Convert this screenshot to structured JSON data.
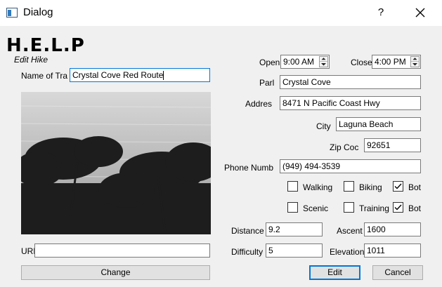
{
  "window": {
    "title": "Dialog",
    "help_label": "?"
  },
  "header": {
    "logo_text": "H.E.L.P",
    "subtitle": "Edit Hike"
  },
  "form": {
    "name_label": "Name of Tra",
    "name_value": "Crystal Cove Red Route",
    "url_label": "URL",
    "url_value": "",
    "change_label": "Change",
    "open_label": "Open",
    "open_value": "9:00 AM",
    "close_label": "Close",
    "close_value": "4:00 PM",
    "park_label": "Parl",
    "park_value": "Crystal Cove",
    "address_label": "Addres",
    "address_value": "8471 N Pacific Coast Hwy",
    "city_label": "City",
    "city_value": "Laguna Beach",
    "zip_label": "Zip Coc",
    "zip_value": "92651",
    "phone_label": "Phone Numb",
    "phone_value": "(949) 494-3539",
    "activities_row1": [
      {
        "label": "Walking",
        "checked": false
      },
      {
        "label": "Biking",
        "checked": false
      },
      {
        "label": "Bot",
        "checked": true
      }
    ],
    "activities_row2": [
      {
        "label": "Scenic",
        "checked": false
      },
      {
        "label": "Training",
        "checked": true
      },
      {
        "label": "Bot",
        "checked": false
      }
    ],
    "distance_label": "Distance",
    "distance_value": "9.2",
    "ascent_label": "Ascent",
    "ascent_value": "1600",
    "difficulty_label": "Difficulty",
    "difficulty_value": "5",
    "elevation_label": "Elevation",
    "elevation_value": "1011"
  },
  "buttons": {
    "edit": "Edit",
    "cancel": "Cancel"
  },
  "colors": {
    "accent": "#0078d7",
    "window_bg": "#f0f0f0",
    "titlebar_bg": "#ffffff"
  }
}
